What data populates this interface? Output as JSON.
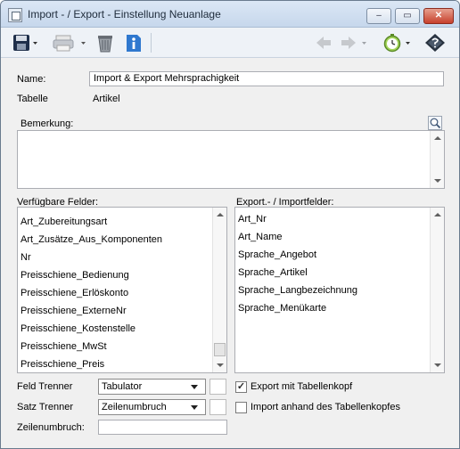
{
  "window": {
    "title": "Import - / Export - Einstellung Neuanlage"
  },
  "titlebar_buttons": {
    "minimize": "‒",
    "maximize": "▭",
    "close": "✕"
  },
  "toolbar": {
    "icons": [
      "save-icon",
      "print-icon",
      "trash-icon",
      "info-icon",
      "back-arrow-icon",
      "forward-arrow-icon",
      "clock-icon",
      "help-icon"
    ]
  },
  "form": {
    "name_label": "Name:",
    "name_value": "Import & Export Mehrsprachigkeit",
    "table_label": "Tabelle",
    "table_value": "Artikel",
    "remark_label": "Bemerkung:",
    "remark_value": ""
  },
  "available_fields": {
    "label": "Verfügbare Felder:",
    "items": [
      "Art_Zubereitungsart",
      "Art_Zusätze_Aus_Komponenten",
      "Nr",
      "Preisschiene_Bedienung",
      "Preisschiene_Erlöskonto",
      "Preisschiene_ExterneNr",
      "Preisschiene_Kostenstelle",
      "Preisschiene_MwSt",
      "Preisschiene_Preis"
    ]
  },
  "export_fields": {
    "label": "Export.- / Importfelder:",
    "items": [
      "Art_Nr",
      "Art_Name",
      "Sprache_Angebot",
      "Sprache_Artikel",
      "Sprache_Langbezeichnung",
      "Sprache_Menükarte"
    ]
  },
  "options": {
    "field_separator_label": "Feld Trenner",
    "field_separator_value": "Tabulator",
    "record_separator_label": "Satz Trenner",
    "record_separator_value": "Zeilenumbruch",
    "line_break_label": "Zeilenumbruch:",
    "line_break_value": "",
    "export_header_label": "Export mit Tabellenkopf",
    "export_header_checked": true,
    "import_by_header_label": "Import anhand des Tabellenkopfes",
    "import_by_header_checked": false
  }
}
